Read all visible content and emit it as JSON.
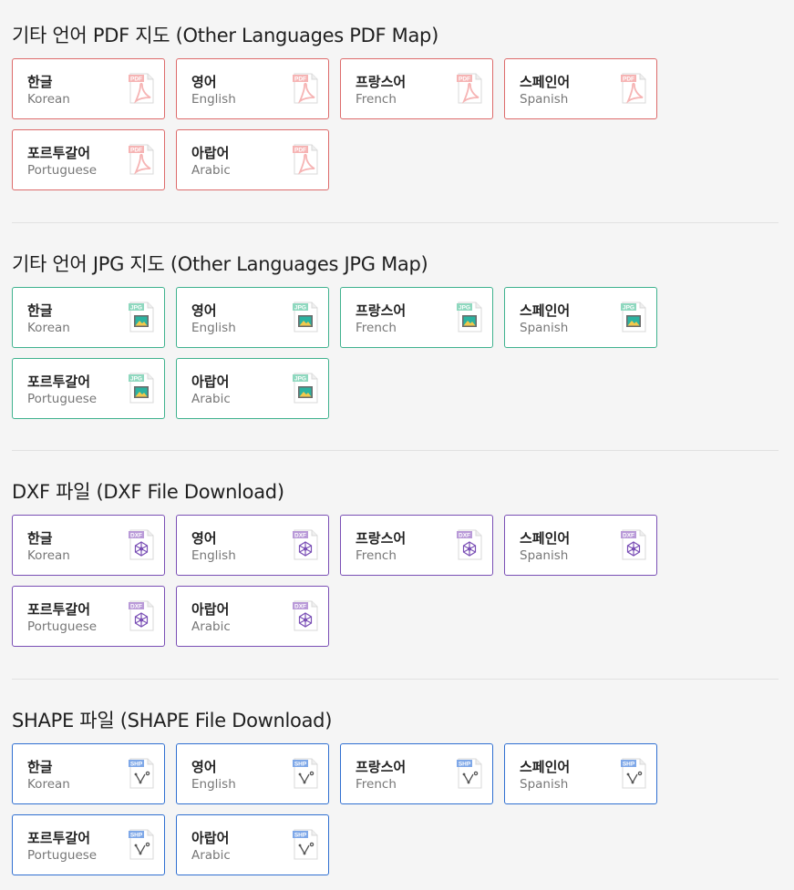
{
  "sections": [
    {
      "title": "기타 언어 PDF 지도 (Other Languages PDF Map)",
      "type": "pdf",
      "color": "#dd6b6b",
      "icon_label": "PDF",
      "icon": "pdf-file-icon",
      "items": [
        {
          "ko": "한글",
          "en": "Korean"
        },
        {
          "ko": "영어",
          "en": "English"
        },
        {
          "ko": "프랑스어",
          "en": "French"
        },
        {
          "ko": "스페인어",
          "en": "Spanish"
        },
        {
          "ko": "포르투갈어",
          "en": "Portuguese"
        },
        {
          "ko": "아랍어",
          "en": "Arabic"
        }
      ]
    },
    {
      "title": "기타 언어 JPG 지도 (Other Languages JPG Map)",
      "type": "jpg",
      "color": "#3fb28e",
      "icon_label": "JPG",
      "icon": "jpg-file-icon",
      "items": [
        {
          "ko": "한글",
          "en": "Korean"
        },
        {
          "ko": "영어",
          "en": "English"
        },
        {
          "ko": "프랑스어",
          "en": "French"
        },
        {
          "ko": "스페인어",
          "en": "Spanish"
        },
        {
          "ko": "포르투갈어",
          "en": "Portuguese"
        },
        {
          "ko": "아랍어",
          "en": "Arabic"
        }
      ]
    },
    {
      "title": "DXF 파일 (DXF File Download)",
      "type": "dxf",
      "color": "#7a4fb5",
      "icon_label": "DXF",
      "icon": "dxf-file-icon",
      "items": [
        {
          "ko": "한글",
          "en": "Korean"
        },
        {
          "ko": "영어",
          "en": "English"
        },
        {
          "ko": "프랑스어",
          "en": "French"
        },
        {
          "ko": "스페인어",
          "en": "Spanish"
        },
        {
          "ko": "포르투갈어",
          "en": "Portuguese"
        },
        {
          "ko": "아랍어",
          "en": "Arabic"
        }
      ]
    },
    {
      "title": "SHAPE 파일 (SHAPE File Download)",
      "type": "shp",
      "color": "#2f6fd1",
      "icon_label": "SHP",
      "icon": "shp-file-icon",
      "items": [
        {
          "ko": "한글",
          "en": "Korean"
        },
        {
          "ko": "영어",
          "en": "English"
        },
        {
          "ko": "프랑스어",
          "en": "French"
        },
        {
          "ko": "스페인어",
          "en": "Spanish"
        },
        {
          "ko": "포르투갈어",
          "en": "Portuguese"
        },
        {
          "ko": "아랍어",
          "en": "Arabic"
        }
      ]
    }
  ]
}
